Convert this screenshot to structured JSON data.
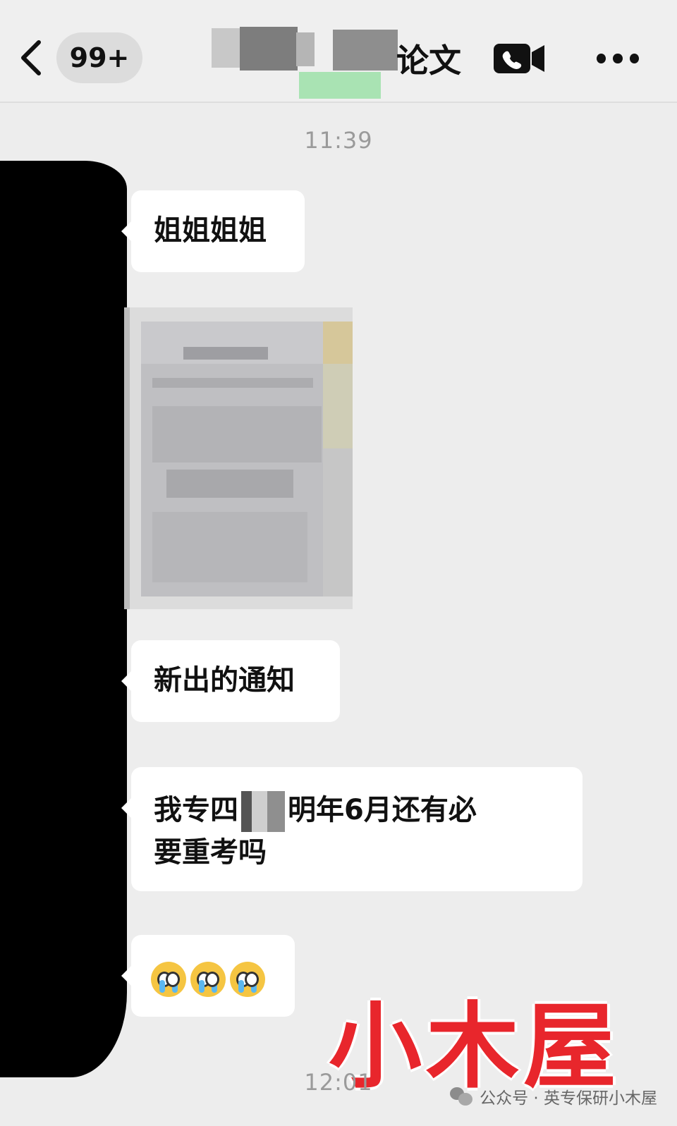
{
  "header": {
    "back_label": "<",
    "unread_count": "99+",
    "title_visible": "论文"
  },
  "messages": {
    "time_1": "11:39",
    "msg_1": "姐姐姐姐",
    "msg_2": "新出的通知",
    "msg_3_a": "我专四",
    "msg_3_b": "明年6月还有必",
    "msg_3_c": "要重考吗",
    "time_2": "12:01"
  },
  "watermark": "小木屋",
  "footer": {
    "credit": "公众号 · 英专保研小木屋"
  },
  "icons": [
    "back-chevron-icon",
    "video-call-icon",
    "more-icon",
    "wechat-icon",
    "crying-face-emoji"
  ]
}
